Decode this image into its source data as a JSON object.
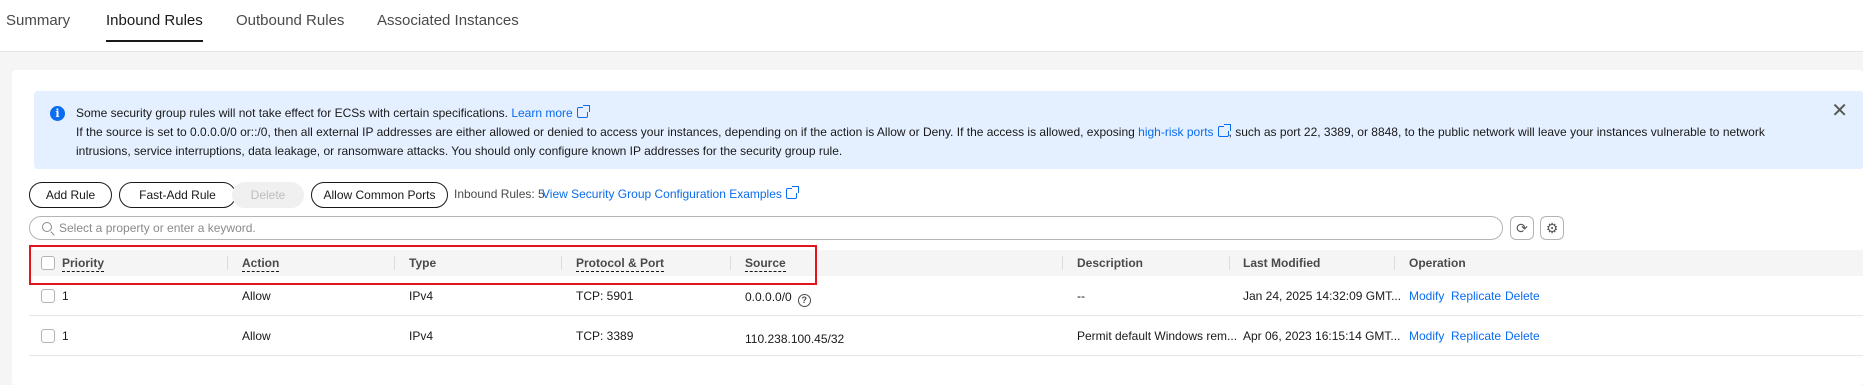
{
  "tabs": [
    "Summary",
    "Inbound Rules",
    "Outbound Rules",
    "Associated Instances"
  ],
  "alert": {
    "line1_text": "Some security group rules will not take effect for ECSs with certain specifications.",
    "line1_link": "Learn more",
    "line2_part1": "If the source is set to 0.0.0.0/0 or::/0, then all external IP addresses are either allowed or denied to access your instances, depending on if the action is Allow or Deny. If the access is allowed, exposing",
    "line2_link": "high-risk ports",
    "line2_part2": ", such as port 22, 3389, or 8848, to the public network will leave your instances vulnerable to network intrusions, service interruptions, data leakage, or ransomware attacks. You should only configure known IP addresses for the security group rule.",
    "close_icon": "close-icon"
  },
  "toolbar": {
    "add_rule": "Add Rule",
    "fast_add_rule": "Fast-Add Rule",
    "delete": "Delete",
    "allow_common_ports": "Allow Common Ports",
    "rules_count": "Inbound Rules: 5",
    "examples_link": "View Security Group Configuration Examples"
  },
  "search": {
    "placeholder": "Select a property or enter a keyword."
  },
  "table": {
    "headers": {
      "priority": "Priority",
      "action": "Action",
      "type": "Type",
      "protocol_port": "Protocol & Port",
      "source": "Source",
      "description": "Description",
      "last_modified": "Last Modified",
      "operation": "Operation"
    },
    "rows": [
      {
        "priority": "1",
        "action": "Allow",
        "type": "IPv4",
        "protocol_port": "TCP: 5901",
        "source": "0.0.0.0/0",
        "description": "--",
        "last_modified": "Jan 24, 2025 14:32:09 GMT...",
        "ops": [
          "Modify",
          "Replicate",
          "Delete"
        ]
      },
      {
        "priority": "1",
        "action": "Allow",
        "type": "IPv4",
        "protocol_port": "TCP: 3389",
        "source": "110.238.100.45/32",
        "description": "Permit default Windows rem...",
        "last_modified": "Apr 06, 2023 16:15:14 GMT...",
        "ops": [
          "Modify",
          "Replicate",
          "Delete"
        ]
      }
    ]
  },
  "colors": {
    "link": "#0a6cf0",
    "alert_bg": "#e4f0ff",
    "highlight": "#e3151b"
  }
}
